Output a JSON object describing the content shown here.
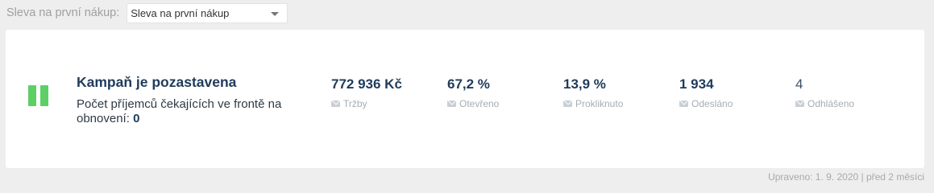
{
  "filter": {
    "label": "Sleva na první nákup:",
    "selected": "Sleva na první nákup"
  },
  "campaign": {
    "status_title": "Kampaň je pozastavena",
    "queue_text": "Počet příjemců čekajících ve frontě na obnovení:",
    "queue_count": "0",
    "status_color": "#5ccf65"
  },
  "metrics": [
    {
      "value": "772 936 Kč",
      "label": "Tržby",
      "icon": "envelope-icon"
    },
    {
      "value": "67,2 %",
      "label": "Otevřeno",
      "icon": "envelope-icon"
    },
    {
      "value": "13,9 %",
      "label": "Prokliknuto",
      "icon": "envelope-icon"
    },
    {
      "value": "1 934",
      "label": "Odesláno",
      "icon": "envelope-icon"
    },
    {
      "value": "4",
      "label": "Odhlášeno",
      "icon": "envelope-icon"
    }
  ],
  "footer": {
    "text": "Upraveno: 1. 9. 2020 | před 2 měsíci"
  }
}
